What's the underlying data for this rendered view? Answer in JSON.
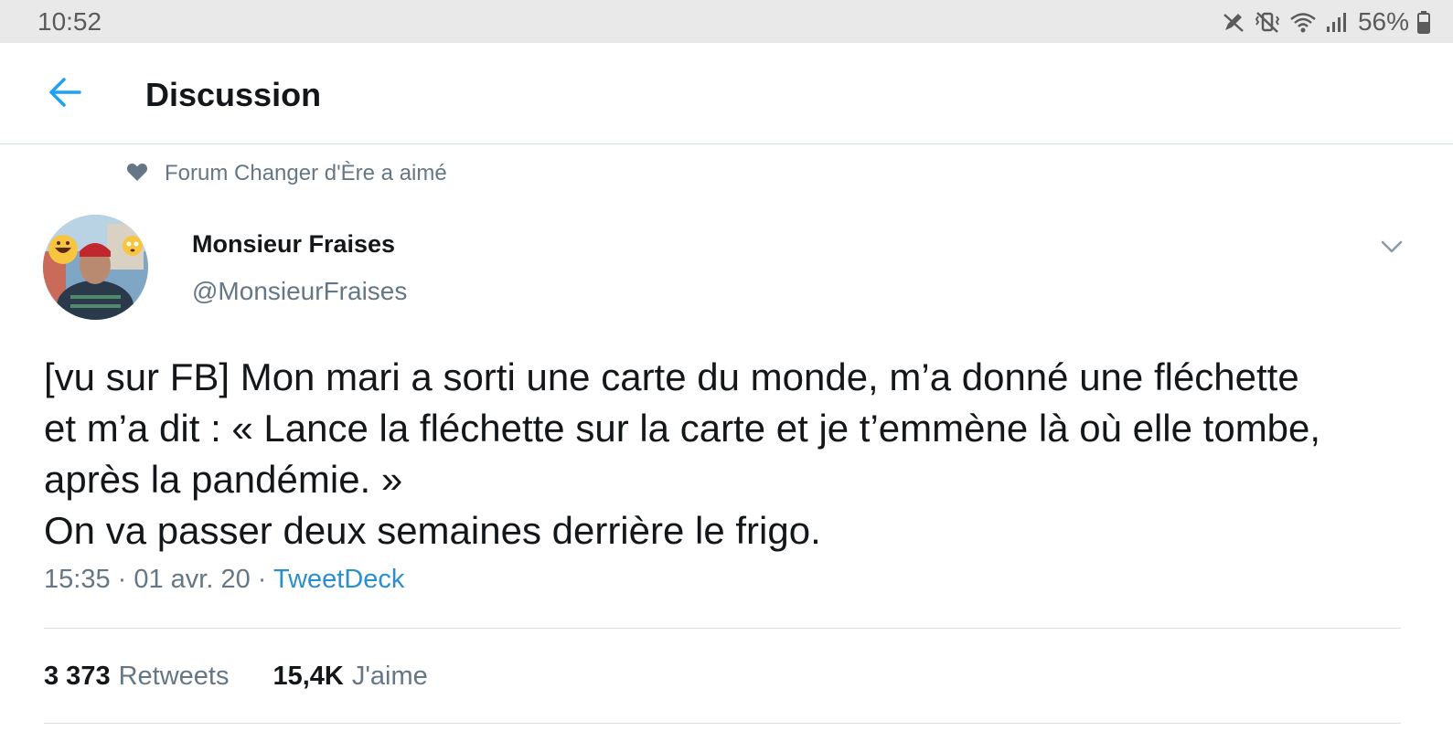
{
  "status_bar": {
    "time": "10:52",
    "battery": "56%",
    "icons": [
      "pen-off-icon",
      "vibrate-mute-icon",
      "wifi-icon",
      "signal-icon",
      "battery-icon"
    ]
  },
  "header": {
    "back_icon": "arrow-left-icon",
    "title": "Discussion"
  },
  "social_context": {
    "icon": "heart-icon",
    "text": "Forum Changer d'Ère a aimé"
  },
  "tweet": {
    "author_name": "Monsieur Fraises",
    "author_handle": "@MonsieurFraises",
    "text_lines": [
      "[vu sur FB] Mon mari a sorti une carte du monde, m’a donné une fléchette",
      "et m’a dit : « Lance la fléchette sur la carte et je t’emmène là où elle tombe,",
      "après la pandémie. »",
      "On va passer deux semaines derrière le frigo."
    ],
    "timestamp": "15:35 · 01 avr. 20 · ",
    "source": "TweetDeck",
    "stats": {
      "retweets_count": "3 373",
      "retweets_label": "Retweets",
      "likes_count": "15,4K",
      "likes_label": "J'aime"
    }
  },
  "colors": {
    "accent": "#1da1f2",
    "secondary_text": "#657786",
    "primary_text": "#14171a",
    "status_bar_bg": "#e9e9e9"
  }
}
